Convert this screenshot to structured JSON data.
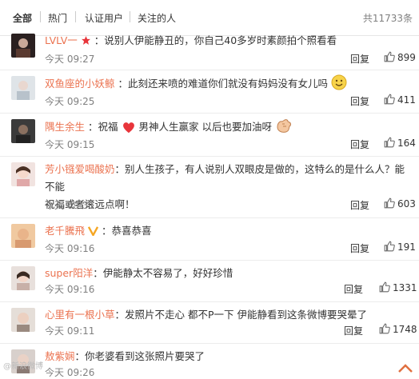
{
  "tabs": [
    {
      "label": "全部"
    },
    {
      "label": "热门"
    },
    {
      "label": "认证用户"
    },
    {
      "label": "关注的人"
    }
  ],
  "total": "共11733条",
  "reply_label": "回复",
  "comments": [
    {
      "user": "LVLV一",
      "text": "：说别人伊能静丑的，你自己40多岁时素颜拍个照看看",
      "time": "今天 09:27",
      "likes": "899"
    },
    {
      "user": "双鱼座的小妖鲸",
      "text": "：此刻还来喷的难道你们就没有妈妈没有女儿吗",
      "time": "今天 09:25",
      "likes": "411"
    },
    {
      "user": "隅生余生",
      "text_a": "：祝福",
      "text_b": "男神人生赢家 以后也要加油呀",
      "time": "今天 09:15",
      "likes": "164"
    },
    {
      "user": "芳小镪爱喝酸奶",
      "text": "：别人生孩子，有人说别人双眼皮是做的，这特么的是什么人？能不能",
      "text2": "祝福或者滚远点啊！",
      "time": "今天 09:31",
      "likes": "603"
    },
    {
      "user": "老千騰飛",
      "text": "：恭喜恭喜",
      "time": "今天 09:16",
      "likes": "191"
    },
    {
      "user": "super阳洋",
      "text": "：伊能静太不容易了，好好珍惜",
      "time": "今天 09:16",
      "likes": "1331"
    },
    {
      "user": "心里有一根小草",
      "text": "：发照片不走心 都不P一下 伊能静看到这条微博要哭晕了",
      "time": "今天 09:11",
      "likes": "1748"
    },
    {
      "user": "敖紫娴",
      "text": "：你老婆看到这张照片要哭了",
      "time": "今天 09:26",
      "likes": ""
    }
  ],
  "watermark": "@新浪微博",
  "colors": {
    "username": "#eb7350",
    "meta": "#808080",
    "heart": "#e8353b"
  }
}
